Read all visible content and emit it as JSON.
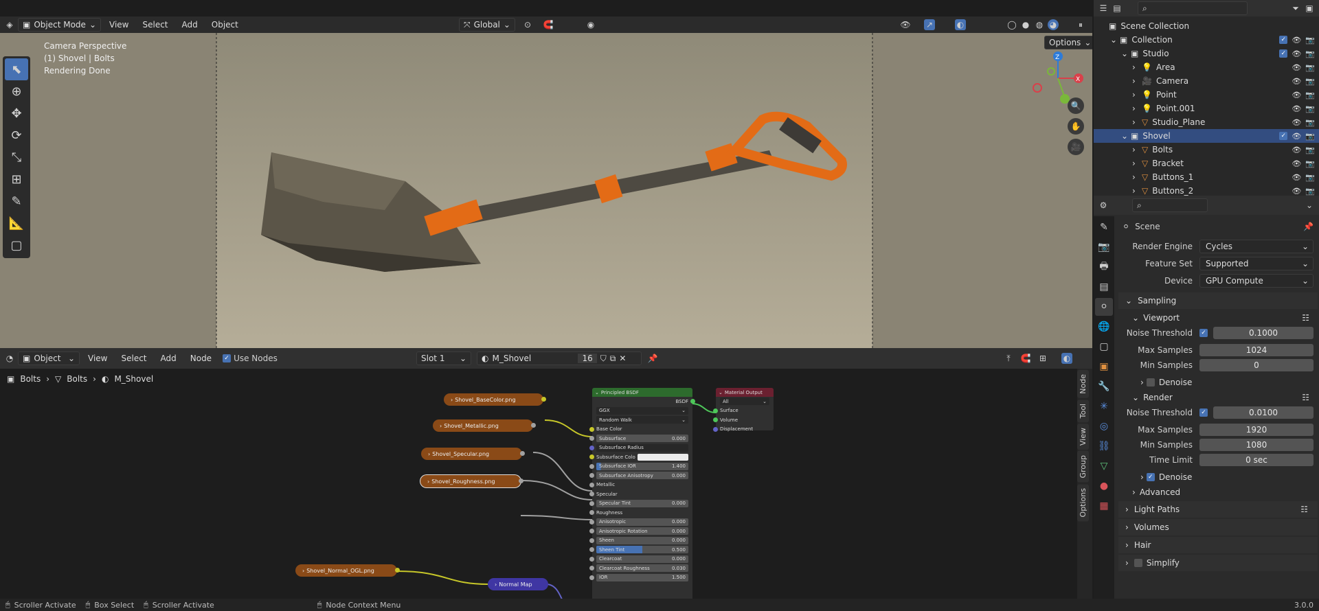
{
  "viewport": {
    "mode": "Object Mode",
    "menus": [
      "View",
      "Select",
      "Add",
      "Object"
    ],
    "transform_orientation": "Global",
    "options_label": "Options",
    "overlay_lines": [
      "Camera Perspective",
      "(1) Shovel | Bolts",
      "Rendering Done"
    ],
    "gizmo_axes": [
      "X",
      "Y",
      "Z"
    ]
  },
  "outliner": {
    "search_placeholder": "",
    "items": [
      {
        "label": "Scene Collection",
        "indent": 0,
        "icon": "collection-icon"
      },
      {
        "label": "Collection",
        "indent": 1,
        "icon": "collection-icon"
      },
      {
        "label": "Studio",
        "indent": 2,
        "icon": "collection-icon"
      },
      {
        "label": "Area",
        "indent": 3,
        "icon": "light-icon"
      },
      {
        "label": "Camera",
        "indent": 3,
        "icon": "camera-icon"
      },
      {
        "label": "Point",
        "indent": 3,
        "icon": "light-icon"
      },
      {
        "label": "Point.001",
        "indent": 3,
        "icon": "light-icon"
      },
      {
        "label": "Studio_Plane",
        "indent": 3,
        "icon": "mesh-icon"
      },
      {
        "label": "Shovel",
        "indent": 2,
        "icon": "collection-icon",
        "selected": true
      },
      {
        "label": "Bolts",
        "indent": 3,
        "icon": "mesh-icon"
      },
      {
        "label": "Bracket",
        "indent": 3,
        "icon": "mesh-icon"
      },
      {
        "label": "Buttons_1",
        "indent": 3,
        "icon": "mesh-icon"
      },
      {
        "label": "Buttons_2",
        "indent": 3,
        "icon": "mesh-icon"
      }
    ]
  },
  "properties": {
    "context": "Scene",
    "render_engine_label": "Render Engine",
    "render_engine": "Cycles",
    "feature_set_label": "Feature Set",
    "feature_set": "Supported",
    "device_label": "Device",
    "device": "GPU Compute",
    "sampling": "Sampling",
    "viewport": "Viewport",
    "vp_noise_label": "Noise Threshold",
    "vp_noise": "0.1000",
    "vp_max_label": "Max Samples",
    "vp_max": "1024",
    "vp_min_label": "Min Samples",
    "vp_min": "0",
    "denoise": "Denoise",
    "render": "Render",
    "r_noise_label": "Noise Threshold",
    "r_noise": "0.0100",
    "r_max_label": "Max Samples",
    "r_max": "1920",
    "r_min_label": "Min Samples",
    "r_min": "1080",
    "time_limit_label": "Time Limit",
    "time_limit": "0 sec",
    "denoise2": "Denoise",
    "advanced": "Advanced",
    "light_paths": "Light Paths",
    "volumes": "Volumes",
    "hair": "Hair",
    "simplify": "Simplify"
  },
  "node_editor": {
    "object_mode": "Object",
    "menus": [
      "View",
      "Select",
      "Add",
      "Node"
    ],
    "use_nodes": "Use Nodes",
    "slot": "Slot 1",
    "material": "M_Shovel",
    "users": "16",
    "breadcrumb": [
      "Bolts",
      "Bolts",
      "M_Shovel"
    ],
    "side_tabs": [
      "Node",
      "Tool",
      "View",
      "Group",
      "Options"
    ],
    "textures": [
      "Shovel_BaseColor.png",
      "Shovel_Metallic.png",
      "Shovel_Specular.png",
      "Shovel_Roughness.png",
      "Shovel_Normal_OGL.png"
    ],
    "normal_map": "Normal Map",
    "bsdf": {
      "title": "Principled BSDF",
      "output": "BSDF",
      "distribution": "GGX",
      "sss_method": "Random Walk",
      "rows": [
        {
          "label": "Base Color",
          "value": ""
        },
        {
          "label": "Subsurface",
          "value": "0.000"
        },
        {
          "label": "Subsurface Radius",
          "value": ""
        },
        {
          "label": "Subsurface Colo",
          "value": ""
        },
        {
          "label": "Subsurface IOR",
          "value": "1.400"
        },
        {
          "label": "Subsurface Anisotropy",
          "value": "0.000"
        },
        {
          "label": "Metallic",
          "value": ""
        },
        {
          "label": "Specular",
          "value": ""
        },
        {
          "label": "Specular Tint",
          "value": "0.000"
        },
        {
          "label": "Roughness",
          "value": ""
        },
        {
          "label": "Anisotropic",
          "value": "0.000"
        },
        {
          "label": "Anisotropic Rotation",
          "value": "0.000"
        },
        {
          "label": "Sheen",
          "value": "0.000"
        },
        {
          "label": "Sheen Tint",
          "value": "0.500"
        },
        {
          "label": "Clearcoat",
          "value": "0.000"
        },
        {
          "label": "Clearcoat Roughness",
          "value": "0.030"
        },
        {
          "label": "IOR",
          "value": "1.500"
        }
      ]
    },
    "output_node": {
      "title": "Material Output",
      "target": "All",
      "inputs": [
        "Surface",
        "Volume",
        "Displacement"
      ]
    }
  },
  "status": {
    "items": [
      "Scroller Activate",
      "Box Select",
      "Scroller Activate",
      "Node Context Menu"
    ],
    "version": "3.0.0"
  },
  "colors": {
    "accent": "#4772b3",
    "texture_node": "#8a4a17",
    "bsdf_header": "#2d6b2d",
    "output_header": "#6b2030",
    "vector_node": "#4a3fa0"
  }
}
